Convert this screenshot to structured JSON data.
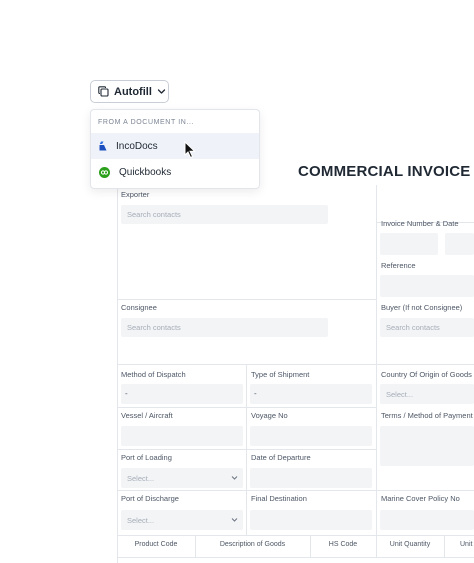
{
  "autofill": {
    "label": "Autofill"
  },
  "dropdown": {
    "header": "FROM A DOCUMENT IN...",
    "items": [
      {
        "label": "IncoDocs",
        "icon": "incodocs-logo-icon"
      },
      {
        "label": "Quickbooks",
        "icon": "quickbooks-logo-icon"
      }
    ]
  },
  "invoice": {
    "title": "COMMERCIAL INVOICE",
    "fields": {
      "exporter": {
        "label": "Exporter",
        "placeholder": "Search contacts"
      },
      "invoice_number_date": {
        "label": "Invoice Number & Date"
      },
      "reference": {
        "label": "Reference"
      },
      "consignee": {
        "label": "Consignee",
        "placeholder": "Search contacts"
      },
      "buyer": {
        "label": "Buyer (If not Consignee)",
        "placeholder": "Search contacts"
      },
      "method_of_dispatch": {
        "label": "Method of Dispatch",
        "value": "-"
      },
      "type_of_shipment": {
        "label": "Type of Shipment",
        "value": "-"
      },
      "country_of_origin": {
        "label": "Country Of Origin of Goods",
        "placeholder": "Select..."
      },
      "vessel_aircraft": {
        "label": "Vessel / Aircraft"
      },
      "voyage_no": {
        "label": "Voyage No"
      },
      "terms_method_payment": {
        "label": "Terms / Method of Payment"
      },
      "port_of_loading": {
        "label": "Port of Loading",
        "placeholder": "Select..."
      },
      "date_of_departure": {
        "label": "Date of Departure"
      },
      "port_of_discharge": {
        "label": "Port of Discharge",
        "placeholder": "Select..."
      },
      "final_destination": {
        "label": "Final Destination"
      },
      "marine_cover_policy": {
        "label": "Marine Cover Policy No"
      }
    },
    "table": {
      "headers": [
        "Product Code",
        "Description of Goods",
        "HS Code",
        "Unit Quantity",
        "Unit"
      ]
    }
  }
}
